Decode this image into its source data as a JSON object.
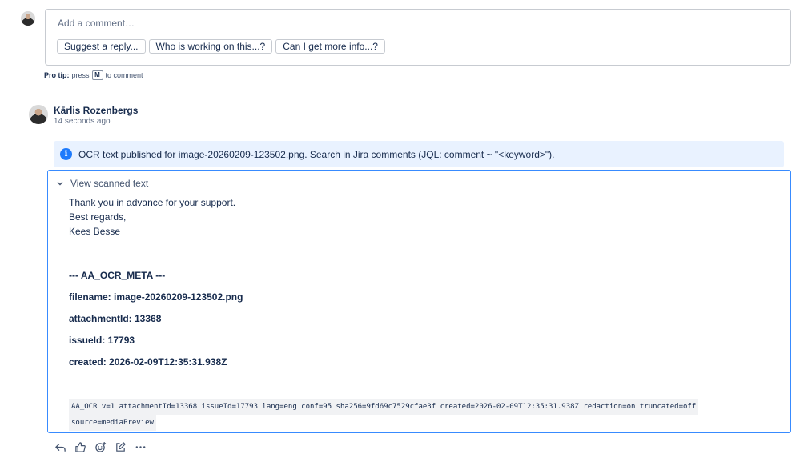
{
  "composer": {
    "placeholder": "Add a comment…",
    "suggestions": [
      "Suggest a reply...",
      "Who is working on this...?",
      "Can I get more info...?"
    ],
    "pro_tip": {
      "label": "Pro tip:",
      "pre": "press",
      "key": "M",
      "post": "to comment"
    }
  },
  "comment": {
    "author": "Kārlis Rozenbergs",
    "time": "14 seconds ago",
    "info_text": "OCR text published for image-20260209-123502.png. Search in Jira comments (JQL: comment ~ \"<keyword>\").",
    "expand_label": "View scanned text",
    "lines": [
      "Thank you in advance for your support.",
      "Best regards,",
      "Kees Besse"
    ],
    "meta": {
      "header": "--- AA_OCR_META ---",
      "filename": "filename: image-20260209-123502.png",
      "attachment": "attachmentId: 13368",
      "issue": "issueId: 17793",
      "created": "created: 2026-02-09T12:35:31.938Z"
    },
    "code": [
      "AA_OCR v=1 attachmentId=13368 issueId=17793 lang=eng conf=95 sha256=9fd69c7529cfae3f created=2026-02-09T12:35:31.938Z redaction=on truncated=off",
      "source=mediaPreview"
    ]
  },
  "actions": [
    "reply-icon",
    "like-icon",
    "emoji-icon",
    "edit-icon",
    "more-icon"
  ]
}
